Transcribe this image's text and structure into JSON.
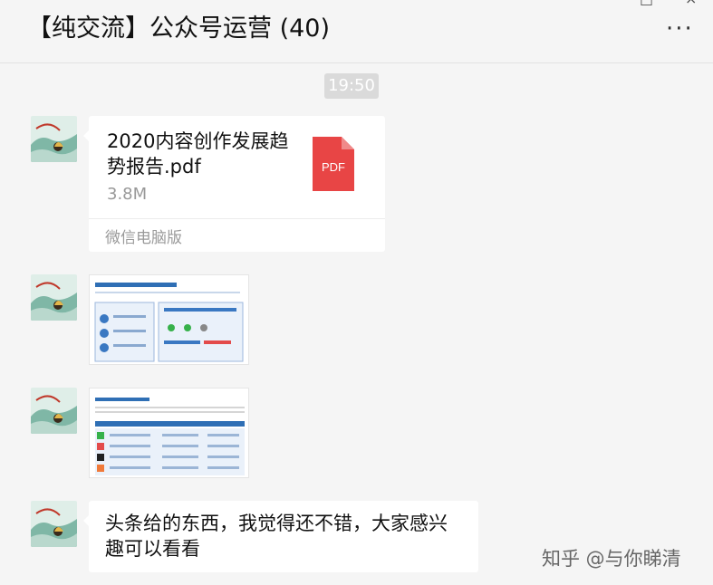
{
  "header": {
    "title": "【纯交流】公众号运营 (40)",
    "more_icon": "more-dots-icon"
  },
  "messages": {
    "timestamp": "19:50",
    "file": {
      "name": "2020内容创作发展趋势报告.pdf",
      "size": "3.8M",
      "source": "微信电脑版",
      "icon_label": "PDF",
      "icon_color": "#e84545"
    },
    "text": "头条给的东西，我觉得还不错，大家感兴趣可以看看"
  },
  "watermark": "知乎 @与你睇清"
}
